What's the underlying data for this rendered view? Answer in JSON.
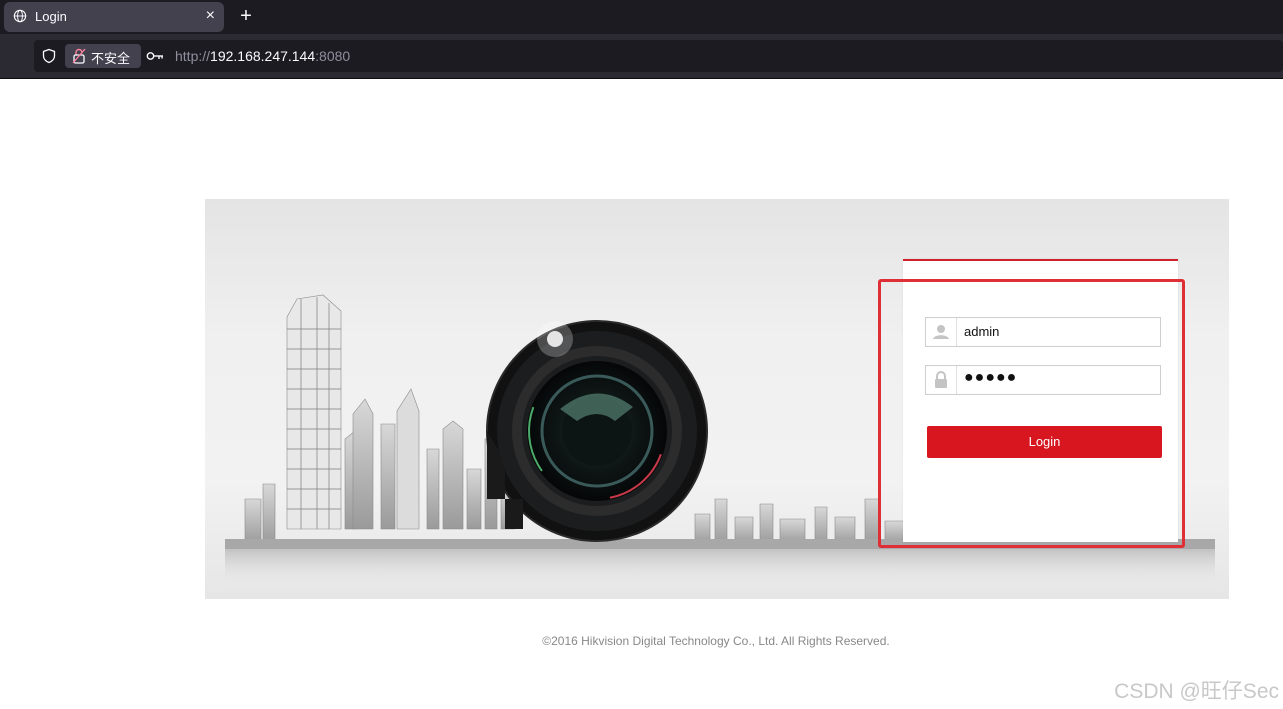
{
  "browser": {
    "tab_title": "Login",
    "tab_close": "×",
    "new_tab": "+",
    "insecure_label": "不安全",
    "url_prefix": "http://",
    "url_host": "192.168.247.144",
    "url_port": ":8080"
  },
  "login": {
    "username_value": "admin",
    "password_mask": "●●●●●",
    "login_label": "Login"
  },
  "footer": {
    "copyright": "©2016 Hikvision Digital Technology Co., Ltd. All Rights Reserved."
  },
  "watermark": "CSDN @旺仔Sec",
  "colors": {
    "accent": "#d7161f",
    "highlight": "#e02e36",
    "chrome_dark": "#1c1b22"
  },
  "icons": [
    "globe-icon",
    "close-icon",
    "plus-icon",
    "shield-icon",
    "lock-icon",
    "key-icon",
    "user-icon",
    "password-lock-icon",
    "camera-lens-illustration"
  ]
}
